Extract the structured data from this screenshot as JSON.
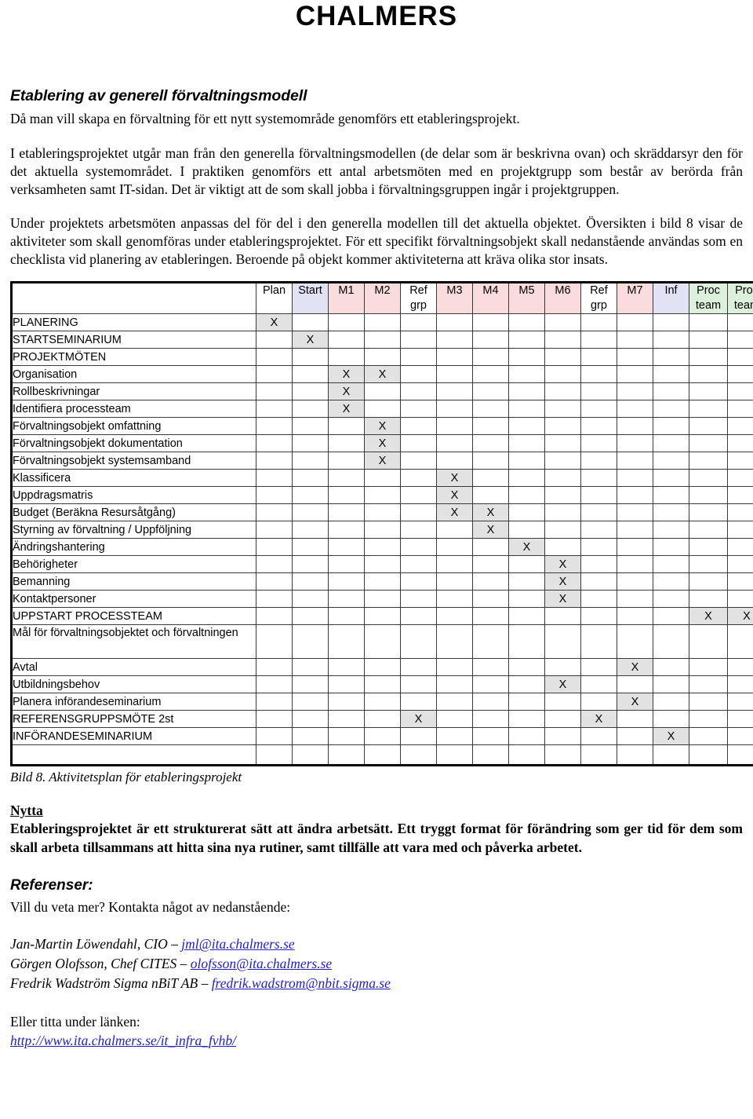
{
  "header": {
    "logo": "CHALMERS"
  },
  "document": {
    "section_title": "Etablering av generell förvaltningsmodell",
    "lead": "Då man vill skapa en förvaltning för ett nytt systemområde genomförs ett etableringsprojekt.",
    "paragraph_1": "I etableringsprojektet utgår man från den generella förvaltningsmodellen (de delar som är beskrivna ovan) och skräddarsyr den för det aktuella systemområdet. I praktiken genomförs ett antal arbetsmöten med en projektgrupp som består av berörda från verksamheten samt IT-sidan. Det är viktigt att de som skall jobba i förvaltningsgruppen ingår i projektgruppen.",
    "paragraph_2": "Under projektets arbetsmöten anpassas del för del i den generella modellen till det aktuella objektet. Översikten i bild 8 visar de aktiviteter som skall genomföras under etableringsprojektet. För ett specifikt förvaltningsobjekt skall nedanstående användas som en checklista vid planering av etableringen. Beroende på objekt kommer aktiviteterna att kräva olika stor insats.",
    "figure_caption": "Bild 8. Aktivitetsplan för etableringsprojekt"
  },
  "activity_table": {
    "columns": [
      {
        "label": "Plan",
        "tint": "hdr-plain"
      },
      {
        "label": "Start",
        "tint": "hdr-blue"
      },
      {
        "label": "M1",
        "tint": "hdr-pink"
      },
      {
        "label": "M2",
        "tint": "hdr-pink"
      },
      {
        "label": "Ref grp",
        "tint": "hdr-plain"
      },
      {
        "label": "M3",
        "tint": "hdr-pink"
      },
      {
        "label": "M4",
        "tint": "hdr-pink"
      },
      {
        "label": "M5",
        "tint": "hdr-pink"
      },
      {
        "label": "M6",
        "tint": "hdr-pink"
      },
      {
        "label": "Ref grp",
        "tint": "hdr-plain"
      },
      {
        "label": "M7",
        "tint": "hdr-pink"
      },
      {
        "label": "Inf",
        "tint": "hdr-blue"
      },
      {
        "label": "Proc team",
        "tint": "hdr-green"
      },
      {
        "label": "Proc team",
        "tint": "hdr-green"
      }
    ],
    "rows": [
      {
        "label": "PLANERING",
        "marks": [
          0
        ]
      },
      {
        "label": "STARTSEMINARIUM",
        "marks": [
          1
        ]
      },
      {
        "label": "PROJEKTMÖTEN",
        "marks": []
      },
      {
        "label": "Organisation",
        "marks": [
          2,
          3
        ]
      },
      {
        "label": "Rollbeskrivningar",
        "marks": [
          2
        ]
      },
      {
        "label": "Identifiera processteam",
        "marks": [
          2
        ]
      },
      {
        "label": "Förvaltningsobjekt omfattning",
        "marks": [
          3
        ]
      },
      {
        "label": "Förvaltningsobjekt dokumentation",
        "marks": [
          3
        ]
      },
      {
        "label": "Förvaltningsobjekt systemsamband",
        "marks": [
          3
        ]
      },
      {
        "label": "Klassificera",
        "marks": [
          5
        ]
      },
      {
        "label": "Uppdragsmatris",
        "marks": [
          5
        ]
      },
      {
        "label": "Budget (Beräkna Resursåtgång)",
        "marks": [
          5,
          6
        ]
      },
      {
        "label": "Styrning av förvaltning / Uppföljning",
        "marks": [
          6
        ]
      },
      {
        "label": "Ändringshantering",
        "marks": [
          7
        ]
      },
      {
        "label": "Behörigheter",
        "marks": [
          8
        ]
      },
      {
        "label": "Bemanning",
        "marks": [
          8
        ]
      },
      {
        "label": "Kontaktpersoner",
        "marks": [
          8
        ]
      },
      {
        "label": "UPPSTART PROCESSTEAM",
        "marks": [
          12,
          13
        ]
      },
      {
        "label": "Mål för förvaltningsobjektet och förvaltningen",
        "marks": [],
        "two_line": true
      },
      {
        "label": "Avtal",
        "marks": [
          10
        ]
      },
      {
        "label": "Utbildningsbehov",
        "marks": [
          8
        ]
      },
      {
        "label": "Planera införandeseminarium",
        "marks": [
          10
        ]
      },
      {
        "label": "REFERENSGRUPPSMÖTE 2st",
        "marks": [
          4,
          9
        ]
      },
      {
        "label": "INFÖRANDESEMINARIUM",
        "marks": [
          11
        ]
      },
      {
        "label": "",
        "marks": [],
        "spacer": true
      }
    ],
    "mark_symbol": "X"
  },
  "benefit": {
    "heading": "Nytta",
    "text": "Etableringsprojektet är ett strukturerat sätt att ändra arbetsätt. Ett tryggt format för förändring som ger tid för dem som skall arbeta tillsammans att hitta sina nya rutiner, samt tillfälle att vara med och påverka arbetet."
  },
  "references": {
    "heading": "Referenser:",
    "intro": "Vill du veta mer? Kontakta något av nedanstående:",
    "contacts": [
      {
        "name": "Jan-Martin Löwendahl, CIO",
        "separator": " – ",
        "email": "jml@ita.chalmers.se"
      },
      {
        "name": "Görgen Olofsson, Chef CITES",
        "separator": " – ",
        "email": "olofsson@ita.chalmers.se"
      },
      {
        "name": "Fredrik Wadström Sigma nBiT AB",
        "separator": " – ",
        "email": "fredrik.wadstrom@nbit.sigma.se"
      }
    ],
    "link_intro": "Eller titta under länken:",
    "url": "http://www.ita.chalmers.se/it_infra_fvhb/"
  },
  "colors": {
    "header_blue": "#e2e2f5",
    "header_pink": "#fadcdc",
    "header_green": "#dcf0dc",
    "mark_cell": "#e2e2e2",
    "link": "#2222bb"
  }
}
